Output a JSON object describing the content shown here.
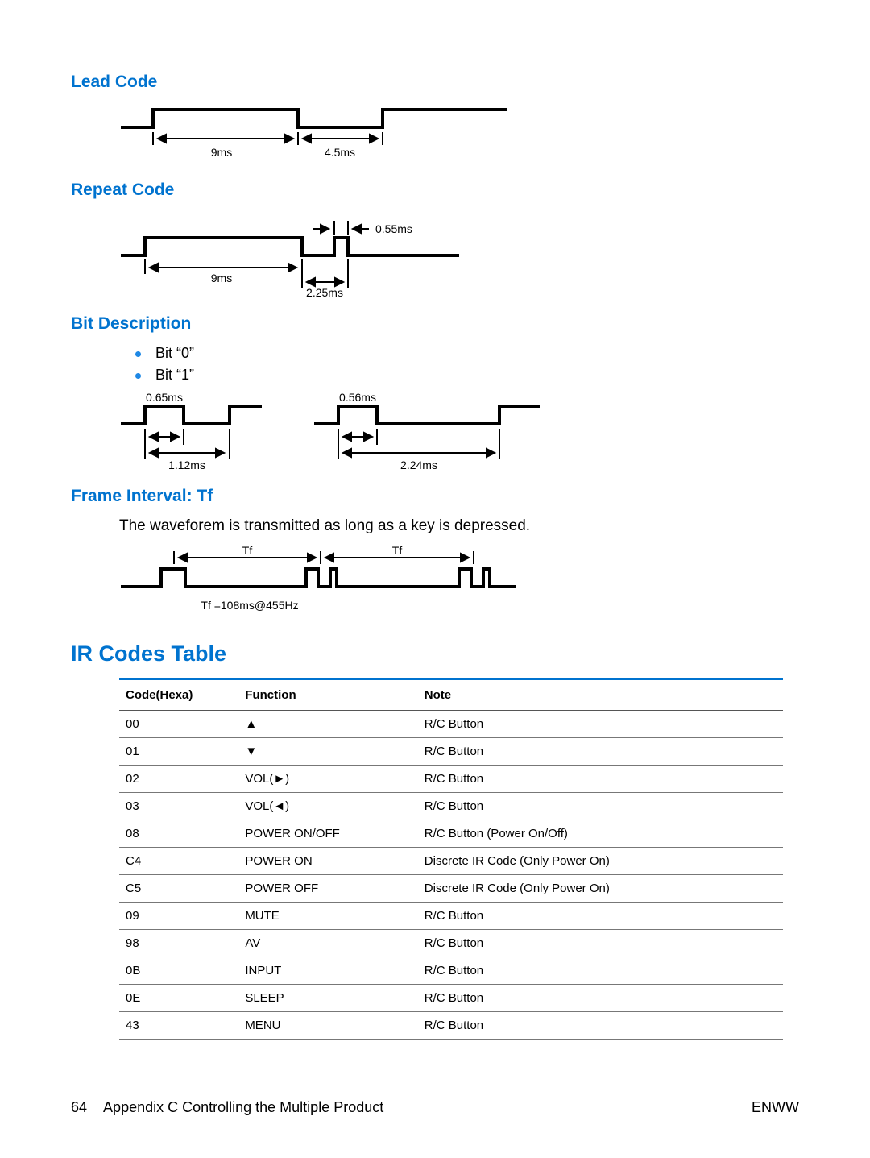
{
  "sections": {
    "lead_code": {
      "heading": "Lead Code",
      "t1": "9ms",
      "t2": "4.5ms"
    },
    "repeat_code": {
      "heading": "Repeat Code",
      "t_wide": "9ms",
      "t_high": "0.55ms",
      "t_low": "2.25ms"
    },
    "bit_desc": {
      "heading": "Bit Description",
      "bit0": "Bit “0”",
      "bit1": "Bit “1”",
      "b0_high": "0.65ms",
      "b0_total": "1.12ms",
      "b1_high": "0.56ms",
      "b1_total": "2.24ms"
    },
    "frame_interval": {
      "heading": "Frame Interval: Tf",
      "text": "The waveforem is transmitted as long as a key is depressed.",
      "tf": "Tf",
      "note": "Tf =108ms@455Hz"
    }
  },
  "ir_table": {
    "heading": "IR Codes Table",
    "headers": [
      "Code(Hexa)",
      "Function",
      "Note"
    ],
    "rows": [
      {
        "code": "00",
        "func": "▲",
        "note": "R/C Button"
      },
      {
        "code": "01",
        "func": "▼",
        "note": "R/C Button"
      },
      {
        "code": "02",
        "func": "VOL(►)",
        "note": "R/C Button"
      },
      {
        "code": "03",
        "func": "VOL(◄)",
        "note": "R/C Button"
      },
      {
        "code": "08",
        "func": "POWER ON/OFF",
        "note": "R/C Button (Power On/Off)"
      },
      {
        "code": "C4",
        "func": "POWER ON",
        "note": "Discrete IR Code (Only Power On)"
      },
      {
        "code": "C5",
        "func": "POWER OFF",
        "note": "Discrete IR Code (Only Power On)"
      },
      {
        "code": "09",
        "func": "MUTE",
        "note": "R/C Button"
      },
      {
        "code": "98",
        "func": "AV",
        "note": "R/C Button"
      },
      {
        "code": "0B",
        "func": "INPUT",
        "note": "R/C Button"
      },
      {
        "code": "0E",
        "func": "SLEEP",
        "note": "R/C Button"
      },
      {
        "code": "43",
        "func": "MENU",
        "note": "R/C Button"
      }
    ]
  },
  "footer": {
    "page_num": "64",
    "chapter": "Appendix C   Controlling the Multiple Product",
    "right": "ENWW"
  }
}
